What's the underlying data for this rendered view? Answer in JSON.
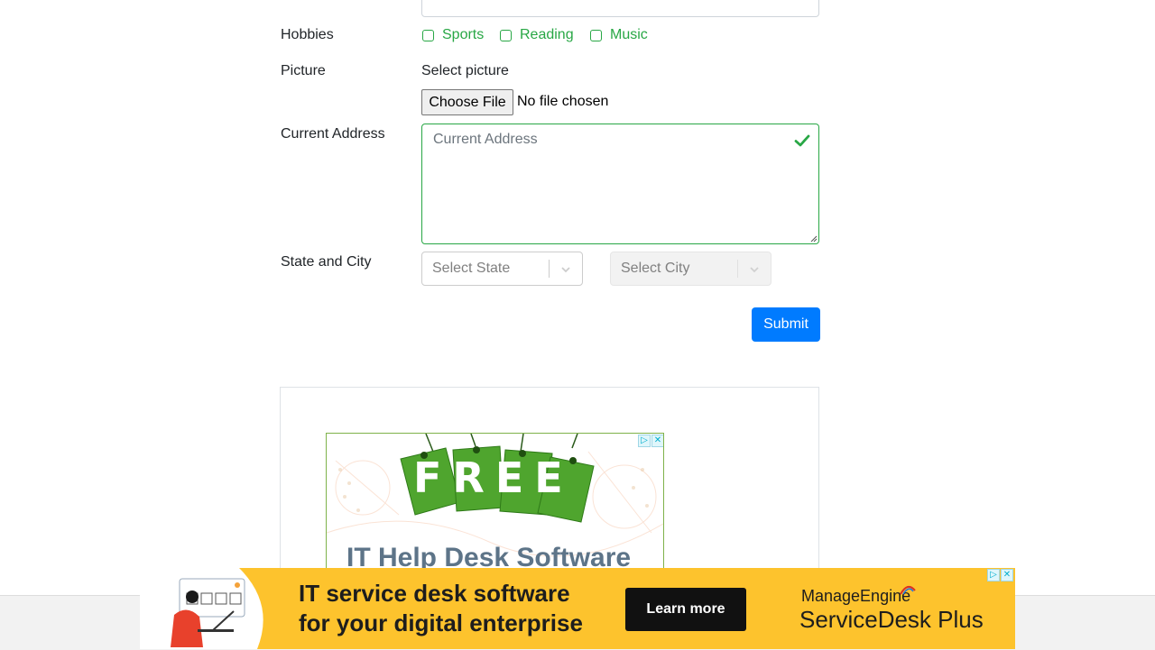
{
  "form": {
    "hobbies": {
      "label": "Hobbies",
      "options": [
        "Sports",
        "Reading",
        "Music"
      ]
    },
    "picture": {
      "label": "Picture",
      "select_label": "Select picture",
      "button": "Choose File",
      "status": "No file chosen"
    },
    "address": {
      "label": "Current Address",
      "placeholder": "Current Address"
    },
    "state_city": {
      "label": "State and City",
      "state_placeholder": "Select State",
      "city_placeholder": "Select City"
    },
    "submit": "Submit"
  },
  "ads": {
    "top_ad": {
      "headline": "FREE",
      "subtitle": "IT Help Desk Software"
    },
    "bottom_ad": {
      "line1": "IT service desk software",
      "line2": "for your digital enterprise",
      "cta": "Learn more",
      "brand1": "ManageEngine",
      "brand2": "ServiceDesk Plus"
    }
  },
  "colors": {
    "valid_green": "#28a745",
    "primary_blue": "#007bff",
    "ad_yellow": "#fdc32d"
  }
}
